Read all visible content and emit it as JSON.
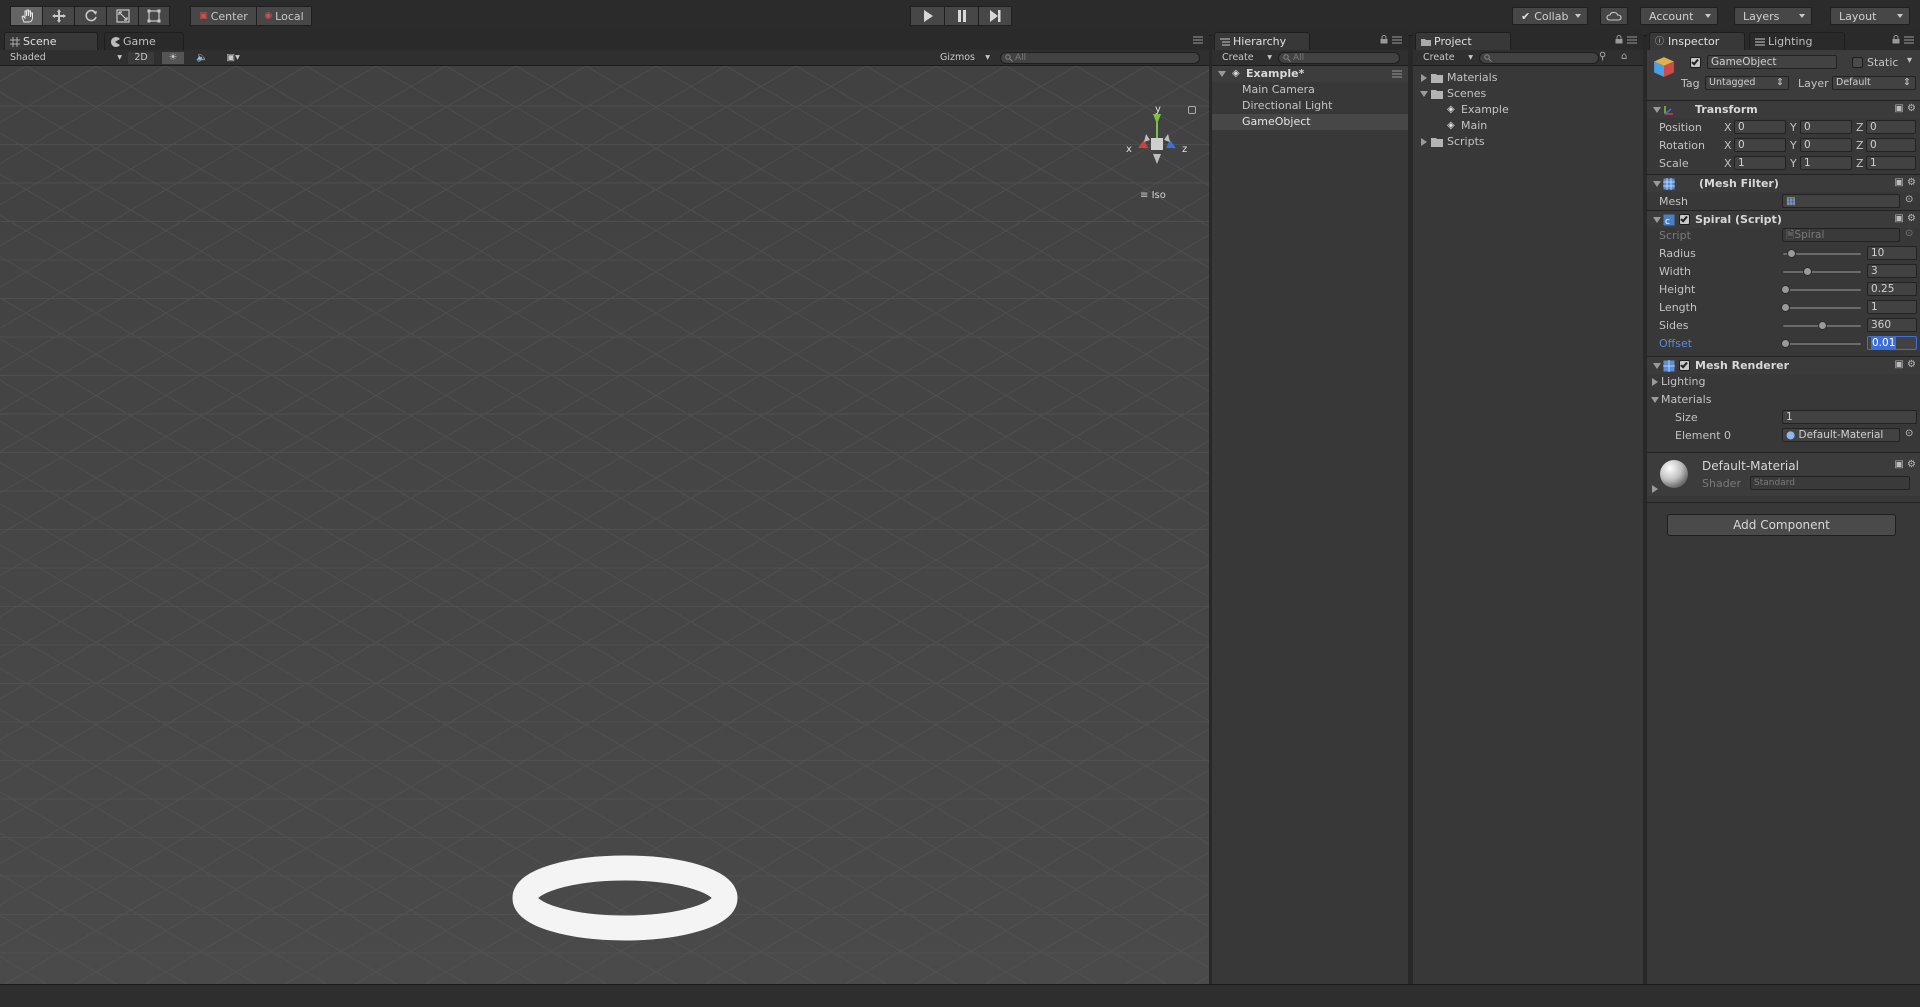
{
  "toolbar": {
    "pivot_label": "Center",
    "space_label": "Local",
    "collab_label": "Collab",
    "account_label": "Account",
    "layers_label": "Layers",
    "layout_label": "Layout"
  },
  "scene_panel": {
    "tabs": [
      "Scene",
      "Game"
    ],
    "shading_mode": "Shaded",
    "mode_2d_label": "2D",
    "gizmos_label": "Gizmos",
    "search_placeholder": "All",
    "gizmo_axes": {
      "x": "x",
      "y": "y",
      "z": "z"
    },
    "projection_label": "Iso"
  },
  "hierarchy": {
    "tab_label": "Hierarchy",
    "create_label": "Create",
    "search_placeholder": "All",
    "scene_name": "Example*",
    "items": [
      "Main Camera",
      "Directional Light",
      "GameObject"
    ],
    "selected_index": 2
  },
  "project": {
    "tab_label": "Project",
    "create_label": "Create",
    "tree": {
      "materials": "Materials",
      "scenes": "Scenes",
      "example": "Example",
      "main": "Main",
      "scripts": "Scripts"
    }
  },
  "inspector": {
    "tabs": [
      "Inspector",
      "Lighting"
    ],
    "object_name": "GameObject",
    "static_label": "Static",
    "tag_label": "Tag",
    "tag_value": "Untagged",
    "layer_label": "Layer",
    "layer_value": "Default",
    "transform": {
      "title": "Transform",
      "position_label": "Position",
      "rotation_label": "Rotation",
      "scale_label": "Scale",
      "x": "X",
      "y": "Y",
      "z": "Z",
      "position": [
        "0",
        "0",
        "0"
      ],
      "rotation": [
        "0",
        "0",
        "0"
      ],
      "scale": [
        "1",
        "1",
        "1"
      ]
    },
    "mesh_filter": {
      "title": "(Mesh Filter)",
      "mesh_label": "Mesh"
    },
    "spiral": {
      "title": "Spiral (Script)",
      "script_label": "Script",
      "script_value": "Spiral",
      "radius_label": "Radius",
      "radius": "10",
      "width_label": "Width",
      "width": "3",
      "height_label": "Height",
      "height": "0.25",
      "length_label": "Length",
      "length": "1",
      "sides_label": "Sides",
      "sides": "360",
      "offset_label": "Offset",
      "offset": "0.01",
      "slider_fractions": {
        "radius": 0.08,
        "width": 0.3,
        "height": 0.0,
        "length": 0.0,
        "sides": 0.5,
        "offset": 0.0
      }
    },
    "mesh_renderer": {
      "title": "Mesh Renderer",
      "lighting_label": "Lighting",
      "materials_label": "Materials",
      "size_label": "Size",
      "size": "1",
      "element0_label": "Element 0",
      "element0": "Default-Material"
    },
    "material": {
      "name": "Default-Material",
      "shader_label": "Shader",
      "shader_value": "Standard"
    },
    "add_component_label": "Add Component"
  },
  "colors": {
    "selection_blue": "#3d6fd6",
    "offset_label_blue": "#5b8ad8"
  }
}
